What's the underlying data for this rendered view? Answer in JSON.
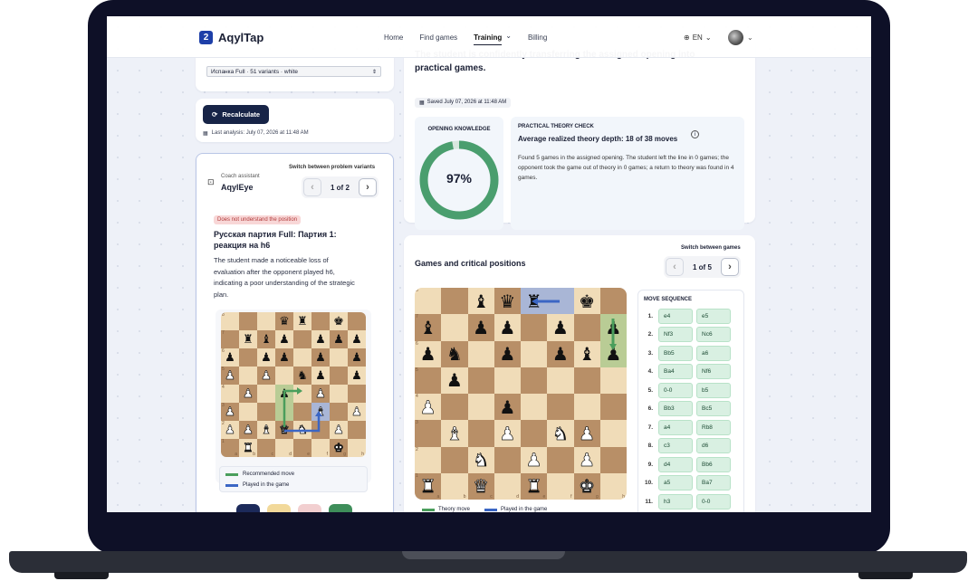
{
  "nav": {
    "brand": "AqylTap",
    "brand_mark": "2",
    "links": [
      "Home",
      "Find games",
      "Training",
      "Billing"
    ],
    "active_chevron": "⌄",
    "lang": "EN",
    "lang_icon": "globe-icon"
  },
  "left": {
    "variant_select": "Испанка Full · 51 variants · white",
    "recalculate": "Recalculate",
    "last_analysis": "Last analysis: July 07, 2026 at 11:48 AM",
    "coach_label": "Coach assistant",
    "coach_name": "AqylEye",
    "switch_label": "Switch between problem variants",
    "pager": "1 of 2",
    "badge": "Does not understand the position",
    "title": "Русская партия Full: Партия 1: реакция на h6",
    "desc": "The student made a noticeable loss of evaluation after the opponent played h6, indicating a poor understanding of the strategic plan.",
    "legend_recommended": "Recommended move",
    "legend_played": "Played in the game",
    "recommended_color": "#4a9e5c",
    "played_color": "#3b66c4",
    "files": [
      "a",
      "b",
      "c",
      "d",
      "e",
      "f",
      "g",
      "h"
    ],
    "ranks": [
      "8",
      "7",
      "6",
      "5",
      "4",
      "3",
      "2",
      "1"
    ]
  },
  "summary": {
    "heading": "The student is confidently transferring the assigned opening into practical games.",
    "saved": "Saved July 07, 2026 at 11:48 AM",
    "knowledge_label": "OPENING KNOWLEDGE",
    "knowledge_pct": "97%",
    "knowledge_value": 97,
    "ring_color": "#4a9e6e",
    "check_label": "PRACTICAL THEORY CHECK",
    "check_title": "Average realized theory depth: 18 of 38 moves",
    "check_text": "Found 5 games in the assigned opening. The student left the line in 0 games; the opponent took the game out of theory in 0 games; a return to theory was found in 4 games."
  },
  "games": {
    "title": "Games and critical positions",
    "switch_label": "Switch between games",
    "pager": "1 of 5",
    "seq_label": "MOVE SEQUENCE",
    "moves": [
      [
        "1.",
        "e4",
        "e5"
      ],
      [
        "2.",
        "Nf3",
        "Nc6"
      ],
      [
        "3.",
        "Bb5",
        "a6"
      ],
      [
        "4.",
        "Ba4",
        "Nf6"
      ],
      [
        "5.",
        "0-0",
        "b5"
      ],
      [
        "6.",
        "Bb3",
        "Bc5"
      ],
      [
        "7.",
        "a4",
        "Rb8"
      ],
      [
        "8.",
        "c3",
        "d6"
      ],
      [
        "9.",
        "d4",
        "Bb6"
      ],
      [
        "10.",
        "a5",
        "Ba7"
      ],
      [
        "11.",
        "h3",
        "0-0"
      ]
    ],
    "legend_theory": "Theory move",
    "legend_played": "Played in the game"
  }
}
